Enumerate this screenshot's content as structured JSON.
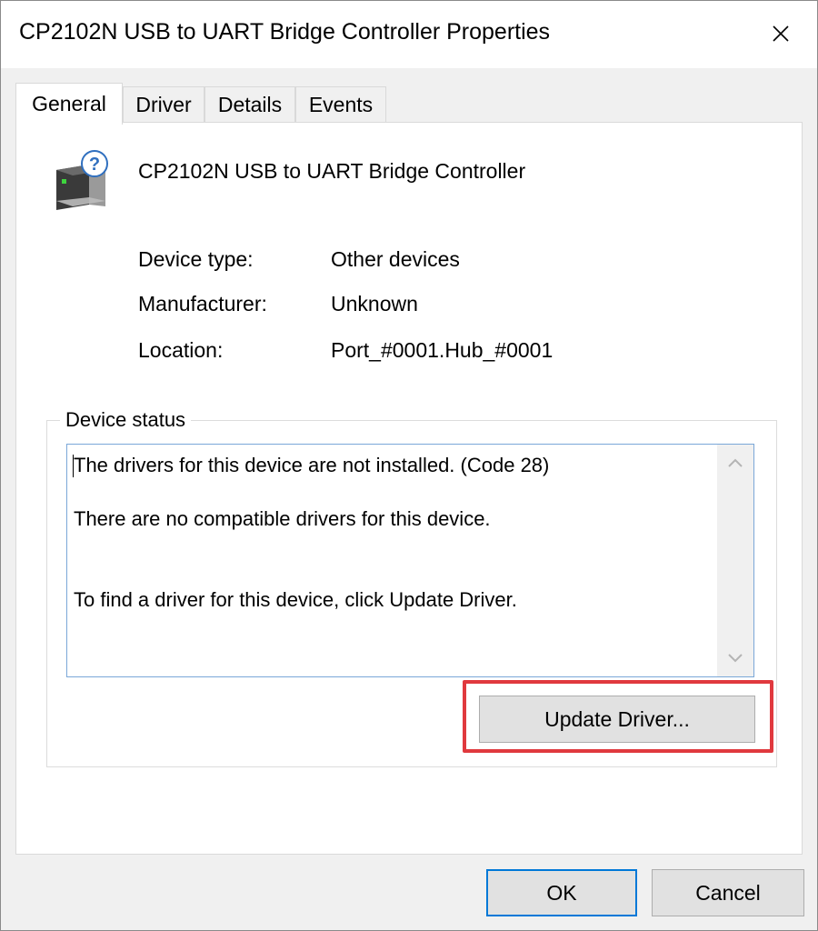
{
  "window": {
    "title": "CP2102N USB to UART Bridge Controller Properties"
  },
  "tabs": [
    {
      "label": "General",
      "active": true
    },
    {
      "label": "Driver",
      "active": false
    },
    {
      "label": "Details",
      "active": false
    },
    {
      "label": "Events",
      "active": false
    }
  ],
  "device": {
    "name": "CP2102N USB to UART Bridge Controller",
    "icon": "unknown-device-icon"
  },
  "properties": [
    {
      "label": "Device type:",
      "value": "Other devices"
    },
    {
      "label": "Manufacturer:",
      "value": "Unknown"
    },
    {
      "label": "Location:",
      "value": "Port_#0001.Hub_#0001"
    }
  ],
  "status": {
    "legend": "Device status",
    "lines": [
      "The drivers for this device are not installed. (Code 28)",
      "There are no compatible drivers for this device.",
      "To find a driver for this device, click Update Driver."
    ]
  },
  "buttons": {
    "update_driver": "Update Driver...",
    "ok": "OK",
    "cancel": "Cancel"
  },
  "colors": {
    "highlight": "#e0393e",
    "focus_blue": "#0078d7",
    "textbox_border": "#7aa7d8"
  }
}
